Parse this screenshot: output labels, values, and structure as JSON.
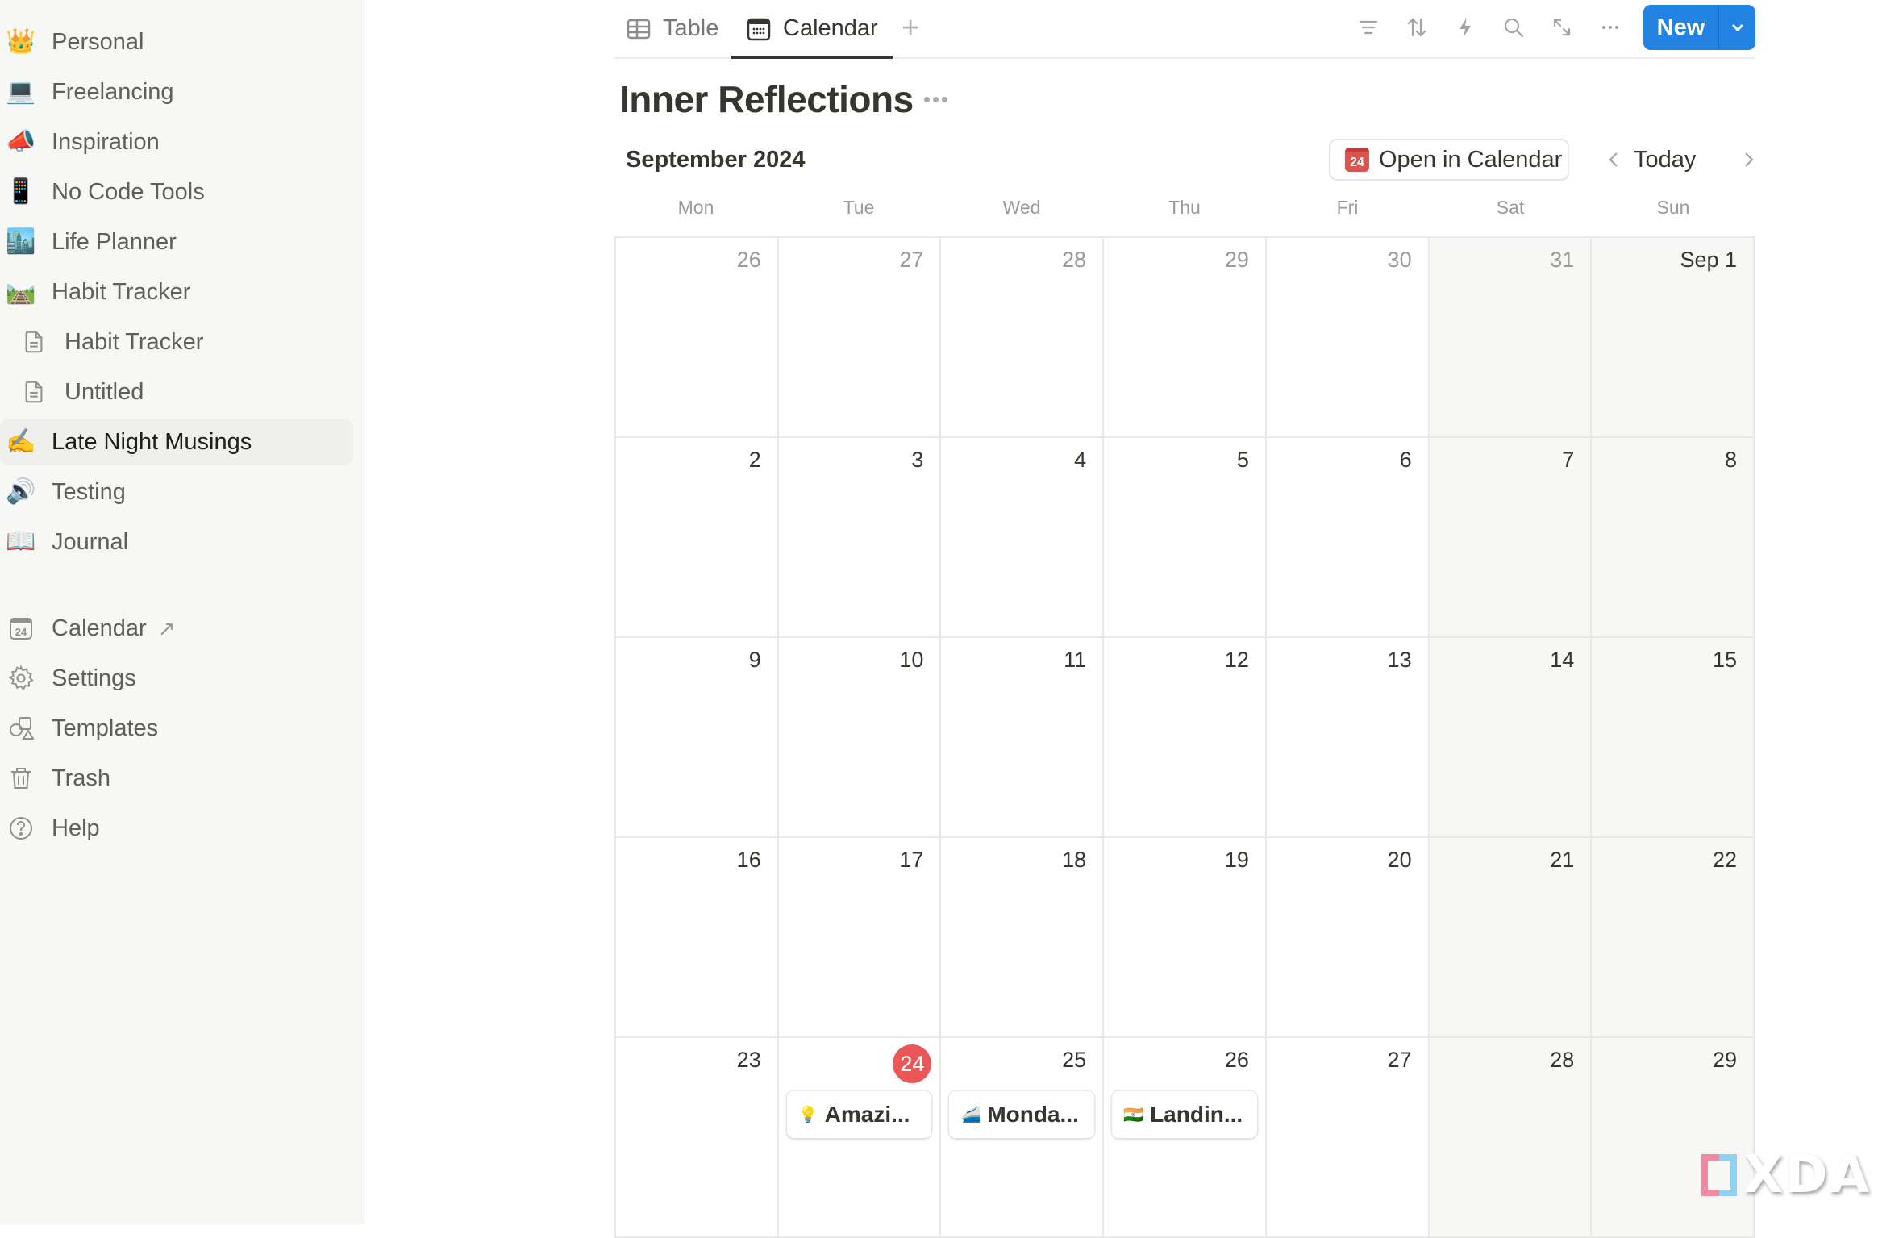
{
  "sidebar": {
    "items": [
      {
        "icon": "👑",
        "icon_name": "crown-icon",
        "label": "Personal"
      },
      {
        "icon": "💻",
        "icon_name": "laptop-icon",
        "label": "Freelancing"
      },
      {
        "icon": "📣",
        "icon_name": "megaphone-icon",
        "label": "Inspiration"
      },
      {
        "icon": "📱",
        "icon_name": "phone-icon",
        "label": "No Code Tools"
      },
      {
        "icon": "🏙️",
        "icon_name": "cityscape-icon",
        "label": "Life Planner"
      },
      {
        "icon": "🛤️",
        "icon_name": "railway-icon",
        "label": "Habit Tracker"
      },
      {
        "icon": "page",
        "icon_name": "page-icon",
        "label": "Habit Tracker"
      },
      {
        "icon": "page",
        "icon_name": "page-icon",
        "label": "Untitled"
      },
      {
        "icon": "✍️",
        "icon_name": "writing-hand-icon",
        "label": "Late Night Musings",
        "active": true
      },
      {
        "icon": "🔊",
        "icon_name": "speaker-icon",
        "label": "Testing"
      },
      {
        "icon": "📖",
        "icon_name": "book-icon",
        "label": "Journal"
      }
    ],
    "utilities": [
      {
        "icon_name": "calendar-icon",
        "icon_text": "24",
        "label": "Calendar",
        "external_icon": "↗"
      },
      {
        "icon_name": "gear-icon",
        "label": "Settings"
      },
      {
        "icon_name": "templates-icon",
        "label": "Templates"
      },
      {
        "icon_name": "trash-icon",
        "label": "Trash"
      },
      {
        "icon_name": "help-icon",
        "label": "Help"
      }
    ]
  },
  "toolbar": {
    "tabs": [
      {
        "label": "Table",
        "icon_name": "table-icon"
      },
      {
        "label": "Calendar",
        "icon_name": "calendar-view-icon",
        "active": true
      }
    ],
    "add_view": "+",
    "tools": [
      "filter-icon",
      "sort-icon",
      "automation-icon",
      "search-icon",
      "expand-icon",
      "more-icon"
    ],
    "new_label": "New",
    "accent": "#2383e2"
  },
  "page": {
    "title": "Inner Reflections",
    "month_label": "September 2024",
    "open_in_calendar": "Open in Calendar",
    "open_in_calendar_icon": "24",
    "today_label": "Today"
  },
  "calendar": {
    "weekdays": [
      "Mon",
      "Tue",
      "Wed",
      "Thu",
      "Fri",
      "Sat",
      "Sun"
    ],
    "today_color": "#eb5757",
    "weeks": [
      [
        {
          "d": "26",
          "other": true
        },
        {
          "d": "27",
          "other": true
        },
        {
          "d": "28",
          "other": true
        },
        {
          "d": "29",
          "other": true
        },
        {
          "d": "30",
          "other": true
        },
        {
          "d": "31",
          "other": true
        },
        {
          "d": "Sep 1"
        }
      ],
      [
        {
          "d": "2"
        },
        {
          "d": "3"
        },
        {
          "d": "4"
        },
        {
          "d": "5"
        },
        {
          "d": "6"
        },
        {
          "d": "7"
        },
        {
          "d": "8"
        }
      ],
      [
        {
          "d": "9"
        },
        {
          "d": "10"
        },
        {
          "d": "11"
        },
        {
          "d": "12"
        },
        {
          "d": "13"
        },
        {
          "d": "14"
        },
        {
          "d": "15"
        }
      ],
      [
        {
          "d": "16"
        },
        {
          "d": "17"
        },
        {
          "d": "18"
        },
        {
          "d": "19"
        },
        {
          "d": "20"
        },
        {
          "d": "21"
        },
        {
          "d": "22"
        }
      ],
      [
        {
          "d": "23"
        },
        {
          "d": "24",
          "today": true,
          "events": [
            {
              "icon": "💡",
              "title": "Amazi..."
            }
          ]
        },
        {
          "d": "25",
          "events": [
            {
              "icon": "🚄",
              "title": "Monda..."
            }
          ]
        },
        {
          "d": "26",
          "events": [
            {
              "icon": "🇮🇳",
              "title": "Landin..."
            }
          ]
        },
        {
          "d": "27"
        },
        {
          "d": "28"
        },
        {
          "d": "29"
        }
      ]
    ]
  },
  "watermark": {
    "text": "XDA"
  }
}
